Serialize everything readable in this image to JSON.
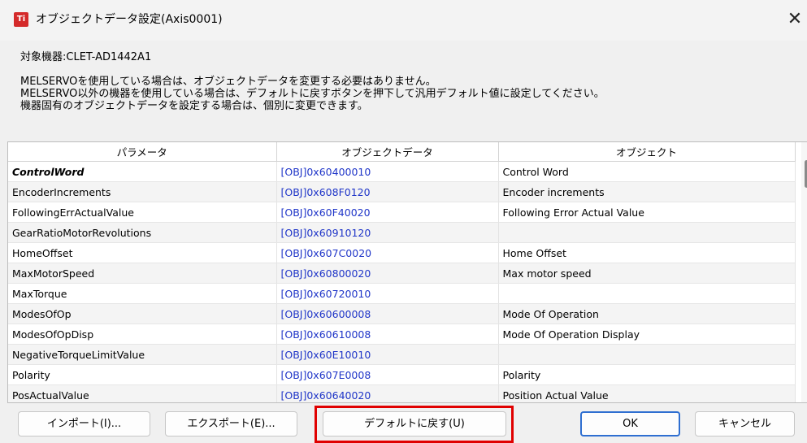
{
  "window": {
    "icon_text": "Ti",
    "title": "オブジェクトデータ設定(Axis0001)",
    "close_glyph": "✕"
  },
  "device_label": "対象機器:CLET-AD1442A1",
  "notes": [
    "MELSERVOを使用している場合は、オブジェクトデータを変更する必要はありません。",
    "MELSERVO以外の機器を使用している場合は、デフォルトに戻すボタンを押下して汎用デフォルト値に設定してください。",
    "機器固有のオブジェクトデータを設定する場合は、個別に変更できます。"
  ],
  "table": {
    "headers": [
      "パラメータ",
      "オブジェクトデータ",
      "オブジェクト"
    ],
    "rows": [
      {
        "param": "ControlWord",
        "data": "[OBJ]0x60400010",
        "object": "Control Word"
      },
      {
        "param": "EncoderIncrements",
        "data": "[OBJ]0x608F0120",
        "object": "Encoder increments"
      },
      {
        "param": "FollowingErrActualValue",
        "data": "[OBJ]0x60F40020",
        "object": "Following Error Actual Value"
      },
      {
        "param": "GearRatioMotorRevolutions",
        "data": "[OBJ]0x60910120",
        "object": ""
      },
      {
        "param": "HomeOffset",
        "data": "[OBJ]0x607C0020",
        "object": "Home Offset"
      },
      {
        "param": "MaxMotorSpeed",
        "data": "[OBJ]0x60800020",
        "object": "Max motor speed"
      },
      {
        "param": "MaxTorque",
        "data": "[OBJ]0x60720010",
        "object": ""
      },
      {
        "param": "ModesOfOp",
        "data": "[OBJ]0x60600008",
        "object": "Mode Of Operation"
      },
      {
        "param": "ModesOfOpDisp",
        "data": "[OBJ]0x60610008",
        "object": "Mode Of Operation Display"
      },
      {
        "param": "NegativeTorqueLimitValue",
        "data": "[OBJ]0x60E10010",
        "object": ""
      },
      {
        "param": "Polarity",
        "data": "[OBJ]0x607E0008",
        "object": "Polarity"
      },
      {
        "param": "PosActualValue",
        "data": "[OBJ]0x60640020",
        "object": "Position Actual Value"
      }
    ]
  },
  "buttons": {
    "import": "インポート(I)...",
    "export": "エクスポート(E)...",
    "default": "デフォルトに戻す(U)",
    "ok": "OK",
    "cancel": "キャンセル"
  },
  "colors": {
    "highlight": "#e00000",
    "object_text": "#1f35c8",
    "ok_border": "#2f6fd1"
  }
}
